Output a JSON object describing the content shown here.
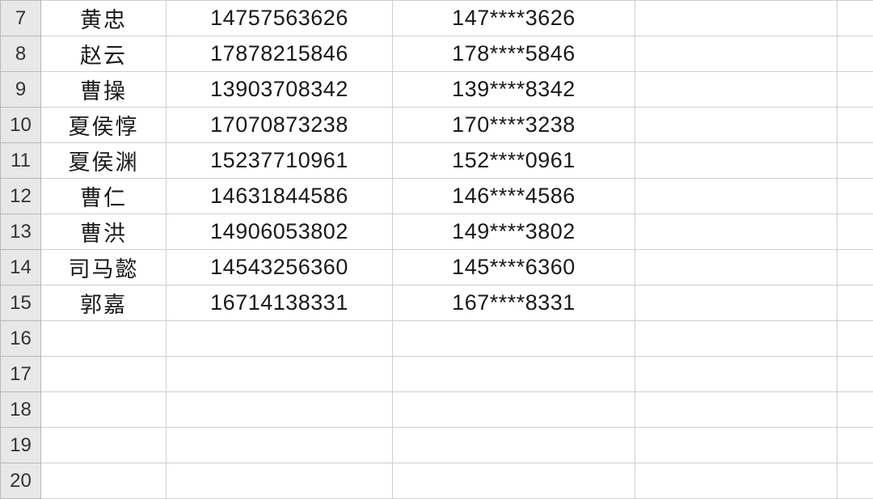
{
  "rows": [
    {
      "num": "7",
      "name": "黄忠",
      "phone": "14757563626",
      "masked": "147****3626"
    },
    {
      "num": "8",
      "name": "赵云",
      "phone": "17878215846",
      "masked": "178****5846"
    },
    {
      "num": "9",
      "name": "曹操",
      "phone": "13903708342",
      "masked": "139****8342"
    },
    {
      "num": "10",
      "name": "夏侯惇",
      "phone": "17070873238",
      "masked": "170****3238"
    },
    {
      "num": "11",
      "name": "夏侯渊",
      "phone": "15237710961",
      "masked": "152****0961"
    },
    {
      "num": "12",
      "name": "曹仁",
      "phone": "14631844586",
      "masked": "146****4586"
    },
    {
      "num": "13",
      "name": "曹洪",
      "phone": "14906053802",
      "masked": "149****3802"
    },
    {
      "num": "14",
      "name": "司马懿",
      "phone": "14543256360",
      "masked": "145****6360"
    },
    {
      "num": "15",
      "name": "郭嘉",
      "phone": "16714138331",
      "masked": "167****8331"
    },
    {
      "num": "16",
      "name": "",
      "phone": "",
      "masked": ""
    },
    {
      "num": "17",
      "name": "",
      "phone": "",
      "masked": ""
    },
    {
      "num": "18",
      "name": "",
      "phone": "",
      "masked": ""
    },
    {
      "num": "19",
      "name": "",
      "phone": "",
      "masked": ""
    },
    {
      "num": "20",
      "name": "",
      "phone": "",
      "masked": ""
    }
  ]
}
